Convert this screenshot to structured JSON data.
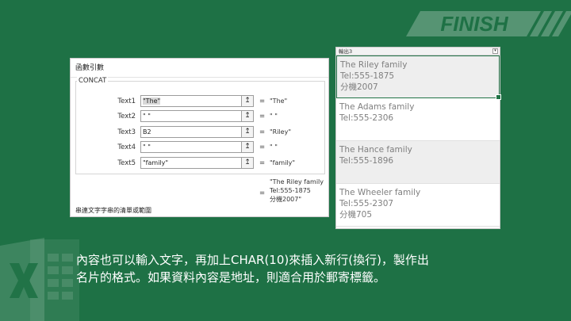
{
  "banner": {
    "text": "FINISH"
  },
  "dialog": {
    "title": "函數引數",
    "function_name": "CONCAT",
    "args": [
      {
        "name": "Text1",
        "value_selected": "\"The\"",
        "value_rest": "",
        "result": "\"The\""
      },
      {
        "name": "Text2",
        "value_selected": "",
        "value_rest": "\" \"",
        "result": "\" \""
      },
      {
        "name": "Text3",
        "value_selected": "",
        "value_rest": "B2",
        "result": "\"Riley\""
      },
      {
        "name": "Text4",
        "value_selected": "",
        "value_rest": "\" \"",
        "result": "\" \""
      },
      {
        "name": "Text5",
        "value_selected": "",
        "value_rest": "\"family\"",
        "result": "\"family\""
      }
    ],
    "collapse_icon": "↥",
    "equals": "=",
    "total_result_lines": [
      "\"The Riley family",
      "Tel:555-1875",
      "分機2007\""
    ],
    "description": "串連文字字串的清單或範圍"
  },
  "cells_panel": {
    "header_label": "輸出3",
    "cells": [
      {
        "lines": [
          "The Riley family",
          "Tel:555-1875",
          "分機2007"
        ],
        "shaded": true,
        "active": true
      },
      {
        "lines": [
          "The Adams family",
          "Tel:555-2306"
        ],
        "shaded": false,
        "active": false
      },
      {
        "lines": [
          "The Hance family",
          "Tel:555-1896"
        ],
        "shaded": true,
        "active": false
      },
      {
        "lines": [
          "The Wheeler family",
          "Tel:555-2307",
          "分機705"
        ],
        "shaded": false,
        "active": false
      }
    ]
  },
  "caption": {
    "line1": "內容也可以輸入文字，再加上CHAR(10)來插入新行(換行)，製作出",
    "line2": "名片的格式。如果資料內容是地址，則適合用於郵寄標籤。"
  },
  "colors": {
    "background": "#1e7145",
    "accent": "#217346",
    "cell_text": "#7f7f7f"
  },
  "icons": {
    "logo": "excel-x-logo-icon",
    "collapse": "collapse-dialog-icon"
  }
}
